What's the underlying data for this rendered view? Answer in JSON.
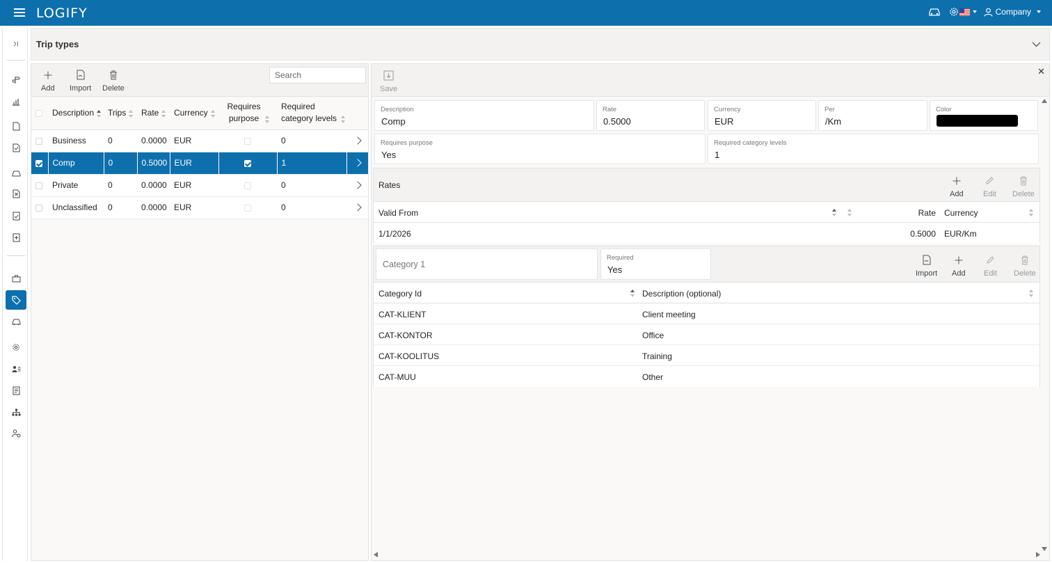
{
  "app": {
    "logo": "LOGIFY",
    "company": "Company"
  },
  "page": {
    "title": "Trip types"
  },
  "list_toolbar": {
    "add": "Add",
    "import": "Import",
    "delete": "Delete",
    "search_placeholder": "Search"
  },
  "list": {
    "columns": [
      "Description",
      "Trips",
      "Rate",
      "Currency",
      "Requires purpose",
      "Required category levels"
    ],
    "rows": [
      {
        "description": "Business",
        "trips": "0",
        "rate": "0.0000",
        "currency": "EUR",
        "requires_purpose": false,
        "levels": "0",
        "selected": false
      },
      {
        "description": "Comp",
        "trips": "0",
        "rate": "0.5000",
        "currency": "EUR",
        "requires_purpose": true,
        "levels": "1",
        "selected": true
      },
      {
        "description": "Private",
        "trips": "0",
        "rate": "0.0000",
        "currency": "EUR",
        "requires_purpose": false,
        "levels": "0",
        "selected": false
      },
      {
        "description": "Unclassified",
        "trips": "0",
        "rate": "0.0000",
        "currency": "EUR",
        "requires_purpose": false,
        "levels": "0",
        "selected": false
      }
    ]
  },
  "detail": {
    "save": "Save",
    "fields": {
      "description": {
        "label": "Description",
        "value": "Comp"
      },
      "rate": {
        "label": "Rate",
        "value": "0.5000"
      },
      "currency": {
        "label": "Currency",
        "value": "EUR"
      },
      "per": {
        "label": "Per",
        "value": "/Km"
      },
      "color": {
        "label": "Color",
        "value": "#000000"
      },
      "requires_purpose": {
        "label": "Requires purpose",
        "value": "Yes"
      },
      "required_levels": {
        "label": "Required category levels",
        "value": "1"
      }
    },
    "rates": {
      "title": "Rates",
      "actions": {
        "add": "Add",
        "edit": "Edit",
        "delete": "Delete"
      },
      "columns": {
        "valid_from": "Valid From",
        "rate": "Rate",
        "currency": "Currency"
      },
      "rows": [
        {
          "valid_from": "1/1/2026",
          "rate": "0.5000",
          "currency": "EUR/Km"
        }
      ]
    },
    "category": {
      "name_placeholder": "Category 1",
      "required": {
        "label": "Required",
        "value": "Yes"
      },
      "actions": {
        "import": "Import",
        "add": "Add",
        "edit": "Edit",
        "delete": "Delete"
      },
      "columns": {
        "id": "Category Id",
        "description": "Description (optional)"
      },
      "rows": [
        {
          "id": "CAT-KLIENT",
          "description": "Client meeting"
        },
        {
          "id": "CAT-KONTOR",
          "description": "Office"
        },
        {
          "id": "CAT-KOOLITUS",
          "description": "Training"
        },
        {
          "id": "CAT-MUU",
          "description": "Other"
        }
      ]
    }
  },
  "colors": {
    "brand": "#0e6fad"
  }
}
